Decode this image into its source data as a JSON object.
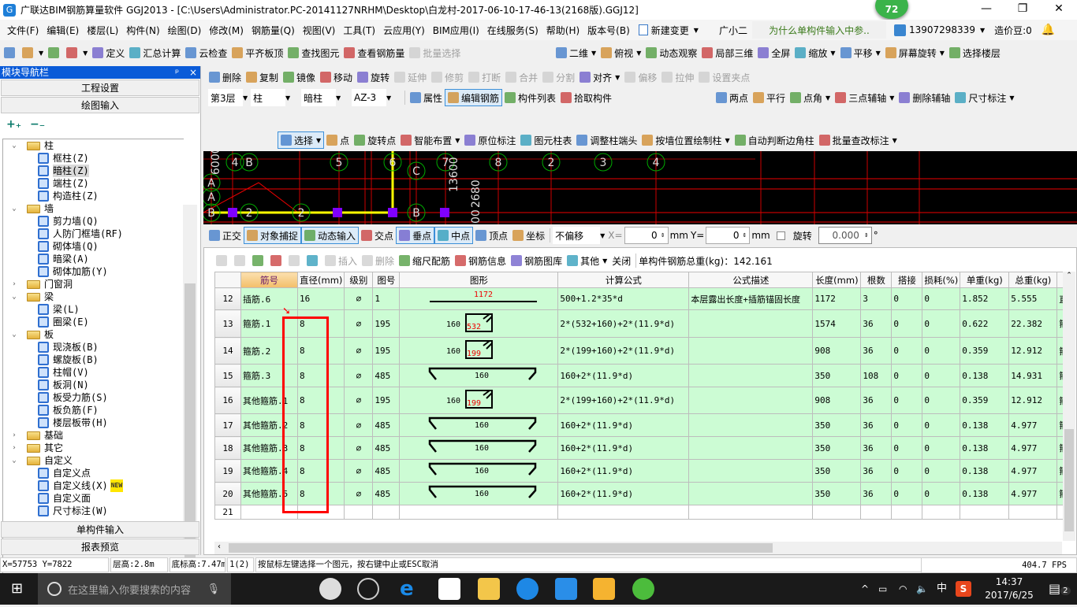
{
  "window": {
    "title": "广联达BIM钢筋算量软件 GGJ2013 - [C:\\Users\\Administrator.PC-20141127NRHM\\Desktop\\白龙村-2017-06-10-17-46-13(2168版).GGJ12]",
    "badge": "72",
    "controls": [
      "—",
      "❐",
      "✕"
    ]
  },
  "menu": {
    "items": [
      "文件(F)",
      "编辑(E)",
      "楼层(L)",
      "构件(N)",
      "绘图(D)",
      "修改(M)",
      "钢筋量(Q)",
      "视图(V)",
      "工具(T)",
      "云应用(Y)",
      "BIM应用(I)",
      "在线服务(S)",
      "帮助(H)",
      "版本号(B)"
    ],
    "new_change": "新建变更",
    "assistant": "广小二",
    "tip": "为什么单构件输入中参..",
    "phone": "13907298339",
    "beans": "造价豆:0"
  },
  "toolbar1": [
    {
      "label": "",
      "icon": "new-file-icon"
    },
    {
      "label": "",
      "icon": "open-folder-icon",
      "dd": true
    },
    {
      "label": "",
      "icon": "save-icon"
    },
    {
      "label": "",
      "icon": "undo-icon",
      "dd": true
    },
    {
      "label": "定义",
      "icon": "define-icon"
    },
    {
      "label": "汇总计算",
      "icon": "sigma-icon"
    },
    {
      "label": "云检查",
      "icon": "cloud-check-icon"
    },
    {
      "label": "平齐板顶",
      "icon": "align-slab-icon"
    },
    {
      "label": "查找图元",
      "icon": "binoculars-icon"
    },
    {
      "label": "查看钢筋量",
      "icon": "view-rebar-icon"
    },
    {
      "label": "批量选择",
      "icon": "batch-select-icon",
      "dis": true
    }
  ],
  "toolbar1b": [
    {
      "label": "二维",
      "icon": "2d-icon",
      "dd": true
    },
    {
      "label": "俯视",
      "icon": "top-view-icon",
      "dd": true
    },
    {
      "label": "动态观察",
      "icon": "orbit-icon"
    },
    {
      "label": "局部三维",
      "icon": "local-3d-icon"
    },
    {
      "label": "全屏",
      "icon": "fullscreen-icon"
    },
    {
      "label": "缩放",
      "icon": "zoom-icon",
      "dd": true
    },
    {
      "label": "平移",
      "icon": "pan-icon",
      "dd": true
    },
    {
      "label": "屏幕旋转",
      "icon": "screen-rotate-icon",
      "dd": true
    },
    {
      "label": "选择楼层",
      "icon": "select-floor-icon"
    }
  ],
  "toolbar2": [
    {
      "label": "删除",
      "icon": "delete-icon"
    },
    {
      "label": "复制",
      "icon": "copy-icon"
    },
    {
      "label": "镜像",
      "icon": "mirror-icon"
    },
    {
      "label": "移动",
      "icon": "move-icon"
    },
    {
      "label": "旋转",
      "icon": "rotate-icon"
    },
    {
      "label": "延伸",
      "icon": "extend-icon",
      "dis": true
    },
    {
      "label": "修剪",
      "icon": "trim-icon",
      "dis": true
    },
    {
      "label": "打断",
      "icon": "break-icon",
      "dis": true
    },
    {
      "label": "合并",
      "icon": "merge-icon",
      "dis": true
    },
    {
      "label": "分割",
      "icon": "split-icon",
      "dis": true
    },
    {
      "label": "对齐",
      "icon": "align-icon",
      "dd": true
    },
    {
      "label": "偏移",
      "icon": "offset-icon",
      "dis": true
    },
    {
      "label": "拉伸",
      "icon": "stretch-icon",
      "dis": true
    },
    {
      "label": "设置夹点",
      "icon": "grip-point-icon",
      "dis": true
    }
  ],
  "selectors": {
    "floor": "第3层",
    "type": "柱",
    "subtype": "暗柱",
    "name": "AZ-3"
  },
  "toolbar3": [
    {
      "label": "属性",
      "icon": "properties-icon"
    },
    {
      "label": "编辑钢筋",
      "icon": "edit-rebar-icon",
      "act": true
    },
    {
      "label": "构件列表",
      "icon": "component-list-icon"
    },
    {
      "label": "拾取构件",
      "icon": "pick-component-icon"
    }
  ],
  "toolbar3b": [
    {
      "label": "两点",
      "icon": "two-point-icon"
    },
    {
      "label": "平行",
      "icon": "parallel-icon"
    },
    {
      "label": "点角",
      "icon": "point-angle-icon",
      "dd": true
    },
    {
      "label": "三点辅轴",
      "icon": "three-point-axis-icon",
      "dd": true
    },
    {
      "label": "删除辅轴",
      "icon": "delete-axis-icon"
    },
    {
      "label": "尺寸标注",
      "icon": "dimension-icon",
      "dd": true
    }
  ],
  "toolbar4": [
    {
      "label": "选择",
      "icon": "cursor-icon",
      "dd": true,
      "act": true
    },
    {
      "label": "点",
      "icon": "point-icon"
    },
    {
      "label": "旋转点",
      "icon": "rotate-point-icon"
    },
    {
      "label": "智能布置",
      "icon": "smart-layout-icon",
      "dd": true
    },
    {
      "label": "原位标注",
      "icon": "in-place-annotation-icon"
    },
    {
      "label": "图元柱表",
      "icon": "column-table-icon"
    },
    {
      "label": "调整柱端头",
      "icon": "adjust-column-end-icon"
    },
    {
      "label": "按墙位置绘制柱",
      "icon": "draw-by-wall-icon",
      "dd": true
    },
    {
      "label": "自动判断边角柱",
      "icon": "auto-corner-column-icon"
    },
    {
      "label": "批量查改标注",
      "icon": "batch-edit-annotation-icon",
      "dd": true
    }
  ],
  "snapbar": [
    {
      "label": "正交",
      "icon": "ortho-icon"
    },
    {
      "label": "对象捕捉",
      "icon": "object-snap-icon",
      "act": true
    },
    {
      "label": "动态输入",
      "icon": "dynamic-input-icon",
      "act": true
    },
    {
      "label": "交点",
      "icon": "intersection-icon"
    },
    {
      "label": "垂点",
      "icon": "perpendicular-icon",
      "act": true
    },
    {
      "label": "中点",
      "icon": "midpoint-icon",
      "act": true
    },
    {
      "label": "顶点",
      "icon": "vertex-icon"
    },
    {
      "label": "坐标",
      "icon": "coordinate-icon"
    }
  ],
  "coords": {
    "offset": "不偏移",
    "x_label": "X=",
    "x": "0",
    "y_label": "Y=",
    "y": "0",
    "unit": "mm",
    "rotate_label": "旋转",
    "rotate": "0.000",
    "deg": "°"
  },
  "cad": {
    "labels": [
      "4",
      "B",
      "5",
      "6",
      "7",
      "8",
      "2",
      "3",
      "4",
      "C",
      "A",
      "A",
      "B",
      "2",
      "2",
      "B",
      "13600",
      "2680",
      "6000",
      "00"
    ]
  },
  "nav": {
    "title": "模块导航栏",
    "pin": "ᵖ",
    "close": "×",
    "btn_setup": "工程设置",
    "btn_draw": "绘图输入",
    "btn_single": "单构件输入",
    "btn_report": "报表预览",
    "tree": [
      {
        "label": "柱",
        "folder": true,
        "open": true
      },
      {
        "label": "框柱(Z)"
      },
      {
        "label": "暗柱(Z)",
        "sel": true
      },
      {
        "label": "端柱(Z)"
      },
      {
        "label": "构造柱(Z)"
      },
      {
        "label": "墙",
        "folder": true,
        "open": true
      },
      {
        "label": "剪力墙(Q)"
      },
      {
        "label": "人防门框墙(RF)"
      },
      {
        "label": "砌体墙(Q)"
      },
      {
        "label": "暗梁(A)"
      },
      {
        "label": "砌体加筋(Y)"
      },
      {
        "label": "门窗洞",
        "folder": true
      },
      {
        "label": "梁",
        "folder": true,
        "open": true
      },
      {
        "label": "梁(L)"
      },
      {
        "label": "圈梁(E)"
      },
      {
        "label": "板",
        "folder": true,
        "open": true
      },
      {
        "label": "现浇板(B)"
      },
      {
        "label": "螺旋板(B)"
      },
      {
        "label": "柱帽(V)"
      },
      {
        "label": "板洞(N)"
      },
      {
        "label": "板受力筋(S)"
      },
      {
        "label": "板负筋(F)"
      },
      {
        "label": "楼层板带(H)"
      },
      {
        "label": "基础",
        "folder": true
      },
      {
        "label": "其它",
        "folder": true
      },
      {
        "label": "自定义",
        "folder": true,
        "open": true
      },
      {
        "label": "自定义点"
      },
      {
        "label": "自定义线(X)",
        "new": "NEW"
      },
      {
        "label": "自定义面"
      },
      {
        "label": "尺寸标注(W)"
      }
    ]
  },
  "grid": {
    "toolbar": [
      {
        "label": "",
        "icon": "first-icon",
        "dis": true
      },
      {
        "label": "",
        "icon": "prev-icon",
        "dis": true
      },
      {
        "label": "",
        "icon": "next-icon"
      },
      {
        "label": "",
        "icon": "last-icon"
      },
      {
        "label": "",
        "icon": "move-up-icon",
        "dis": true
      },
      {
        "label": "",
        "icon": "move-down-icon"
      },
      {
        "label": "插入",
        "icon": "insert-icon",
        "dis": true
      },
      {
        "label": "删除",
        "icon": "delete-row-icon",
        "dis": true
      },
      {
        "label": "缩尺配筋",
        "icon": "scale-rebar-icon"
      },
      {
        "label": "钢筋信息",
        "icon": "rebar-info-icon"
      },
      {
        "label": "钢筋图库",
        "icon": "rebar-library-icon"
      },
      {
        "label": "其他",
        "icon": "other-icon",
        "dd": true
      },
      {
        "label": "关闭",
        "icon": ""
      }
    ],
    "total_label": "单构件钢筋总重(kg)：142.161",
    "columns": [
      "",
      "筋号",
      "直径(mm)",
      "级别",
      "图号",
      "图形",
      "计算公式",
      "公式描述",
      "长度(mm)",
      "根数",
      "搭接",
      "损耗(%)",
      "单重(kg)",
      "总重(kg)",
      ""
    ],
    "rows": [
      {
        "no": "12",
        "name": "插筋.6",
        "dia": "16",
        "grade": "⌀",
        "fig": "1",
        "shape": "line",
        "s1": "1172",
        "s2": "",
        "formula": "500+1.2*35*d",
        "desc": "本层露出长度+插筋锚固长度",
        "len": "1172",
        "count": "3",
        "lap": "0",
        "loss": "0",
        "unit": "1.852",
        "total": "5.555",
        "more": "直"
      },
      {
        "no": "13",
        "name": "箍筋.1",
        "dia": "8",
        "grade": "⌀",
        "fig": "195",
        "shape": "stirrup",
        "s1": "160",
        "s2": "532",
        "formula": "2*(532+160)+2*(11.9*d)",
        "desc": "",
        "len": "1574",
        "count": "36",
        "lap": "0",
        "loss": "0",
        "unit": "0.622",
        "total": "22.382",
        "more": "箍"
      },
      {
        "no": "14",
        "name": "箍筋.2",
        "dia": "8",
        "grade": "⌀",
        "fig": "195",
        "shape": "stirrup",
        "s1": "160",
        "s2": "199",
        "formula": "2*(199+160)+2*(11.9*d)",
        "desc": "",
        "len": "908",
        "count": "36",
        "lap": "0",
        "loss": "0",
        "unit": "0.359",
        "total": "12.912",
        "more": "箍"
      },
      {
        "no": "15",
        "name": "箍筋.3",
        "dia": "8",
        "grade": "⌀",
        "fig": "485",
        "shape": "tie",
        "s1": "160",
        "s2": "",
        "formula": "160+2*(11.9*d)",
        "desc": "",
        "len": "350",
        "count": "108",
        "lap": "0",
        "loss": "0",
        "unit": "0.138",
        "total": "14.931",
        "more": "箍"
      },
      {
        "no": "16",
        "name": "其他箍筋.1",
        "dia": "8",
        "grade": "⌀",
        "fig": "195",
        "shape": "stirrup",
        "s1": "160",
        "s2": "199",
        "formula": "2*(199+160)+2*(11.9*d)",
        "desc": "",
        "len": "908",
        "count": "36",
        "lap": "0",
        "loss": "0",
        "unit": "0.359",
        "total": "12.912",
        "more": "箍"
      },
      {
        "no": "17",
        "name": "其他箍筋.2",
        "dia": "8",
        "grade": "⌀",
        "fig": "485",
        "shape": "tie",
        "s1": "160",
        "s2": "",
        "formula": "160+2*(11.9*d)",
        "desc": "",
        "len": "350",
        "count": "36",
        "lap": "0",
        "loss": "0",
        "unit": "0.138",
        "total": "4.977",
        "more": "箍"
      },
      {
        "no": "18",
        "name": "其他箍筋.3",
        "dia": "8",
        "grade": "⌀",
        "fig": "485",
        "shape": "tie",
        "s1": "160",
        "s2": "",
        "formula": "160+2*(11.9*d)",
        "desc": "",
        "len": "350",
        "count": "36",
        "lap": "0",
        "loss": "0",
        "unit": "0.138",
        "total": "4.977",
        "more": "箍"
      },
      {
        "no": "19",
        "name": "其他箍筋.4",
        "dia": "8",
        "grade": "⌀",
        "fig": "485",
        "shape": "tie",
        "s1": "160",
        "s2": "",
        "formula": "160+2*(11.9*d)",
        "desc": "",
        "len": "350",
        "count": "36",
        "lap": "0",
        "loss": "0",
        "unit": "0.138",
        "total": "4.977",
        "more": "箍"
      },
      {
        "no": "20",
        "name": "其他箍筋.5",
        "dia": "8",
        "grade": "⌀",
        "fig": "485",
        "shape": "tie",
        "s1": "160",
        "s2": "",
        "formula": "160+2*(11.9*d)",
        "desc": "",
        "len": "350",
        "count": "36",
        "lap": "0",
        "loss": "0",
        "unit": "0.138",
        "total": "4.977",
        "more": "箍"
      },
      {
        "no": "21",
        "empty": true
      }
    ]
  },
  "status": {
    "coords": "X=57753 Y=7822",
    "floor_height": "层高:2.8m",
    "base_elev": "底标高:7.47m",
    "count": "1(2)",
    "hint": "按鼠标左键选择一个图元，按右键中止或ESC取消",
    "fps": "404.7 FPS"
  },
  "taskbar": {
    "search_placeholder": "在这里输入你要搜索的内容",
    "ime": "中",
    "time": "14:37",
    "date": "2017/6/25",
    "notif": "2"
  },
  "colors": {
    "row_bg": "#ccfcd4",
    "annotation": "#ff0000",
    "nav_header": "#0a5bd8"
  }
}
